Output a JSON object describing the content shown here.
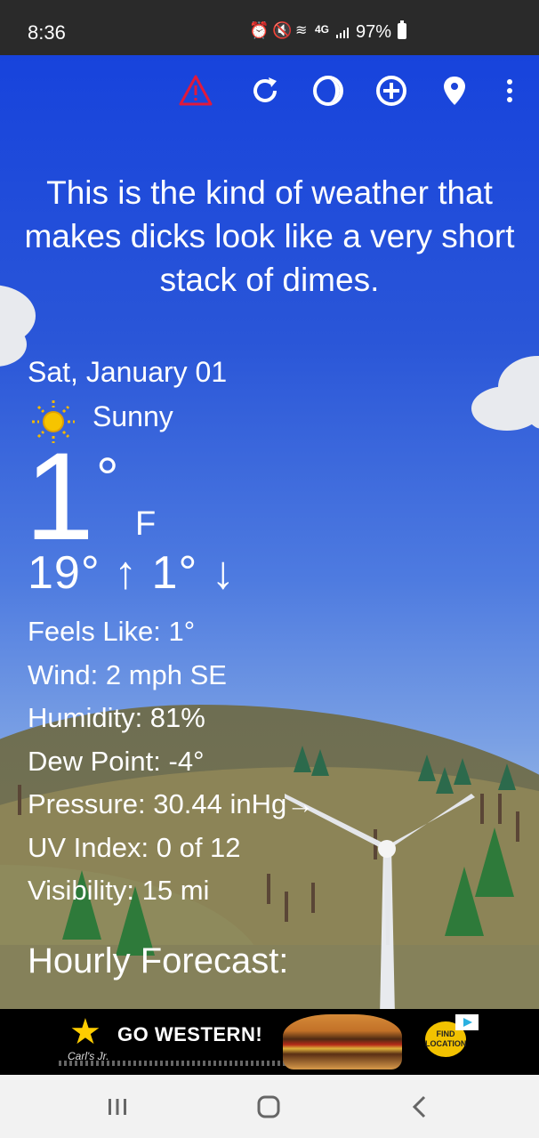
{
  "status_bar": {
    "time": "8:36",
    "battery": "97%"
  },
  "toolbar": {
    "icons": [
      "warning-icon",
      "refresh-icon",
      "theme-icon",
      "add-location-icon",
      "location-pin-icon",
      "more-vert-icon"
    ],
    "warning_color": "#e0193c"
  },
  "weather": {
    "quote": "This is the kind of weather that makes dicks look like a very short stack of dimes.",
    "date": "Sat, January 01",
    "condition": "Sunny",
    "temperature": "1",
    "degree_symbol": "°",
    "unit": "F",
    "high_low": "19° ↑ 1° ↓",
    "stats": {
      "feels_like": "Feels Like:  1°",
      "wind": "Wind:  2 mph SE",
      "humidity": "Humidity:  81%",
      "dew_point": "Dew Point:  -4°",
      "pressure": "Pressure:  30.44 inHg→",
      "uv_index": "UV Index:  0 of 12",
      "visibility": "Visibility:  15 mi"
    },
    "hourly_heading": "Hourly Forecast:"
  },
  "ad": {
    "brand": "Carl's Jr.",
    "headline": "GO WESTERN!",
    "cta": "FIND LOCATION"
  },
  "nav_bar": {
    "buttons": [
      "recents-button",
      "home-button",
      "back-button"
    ]
  }
}
